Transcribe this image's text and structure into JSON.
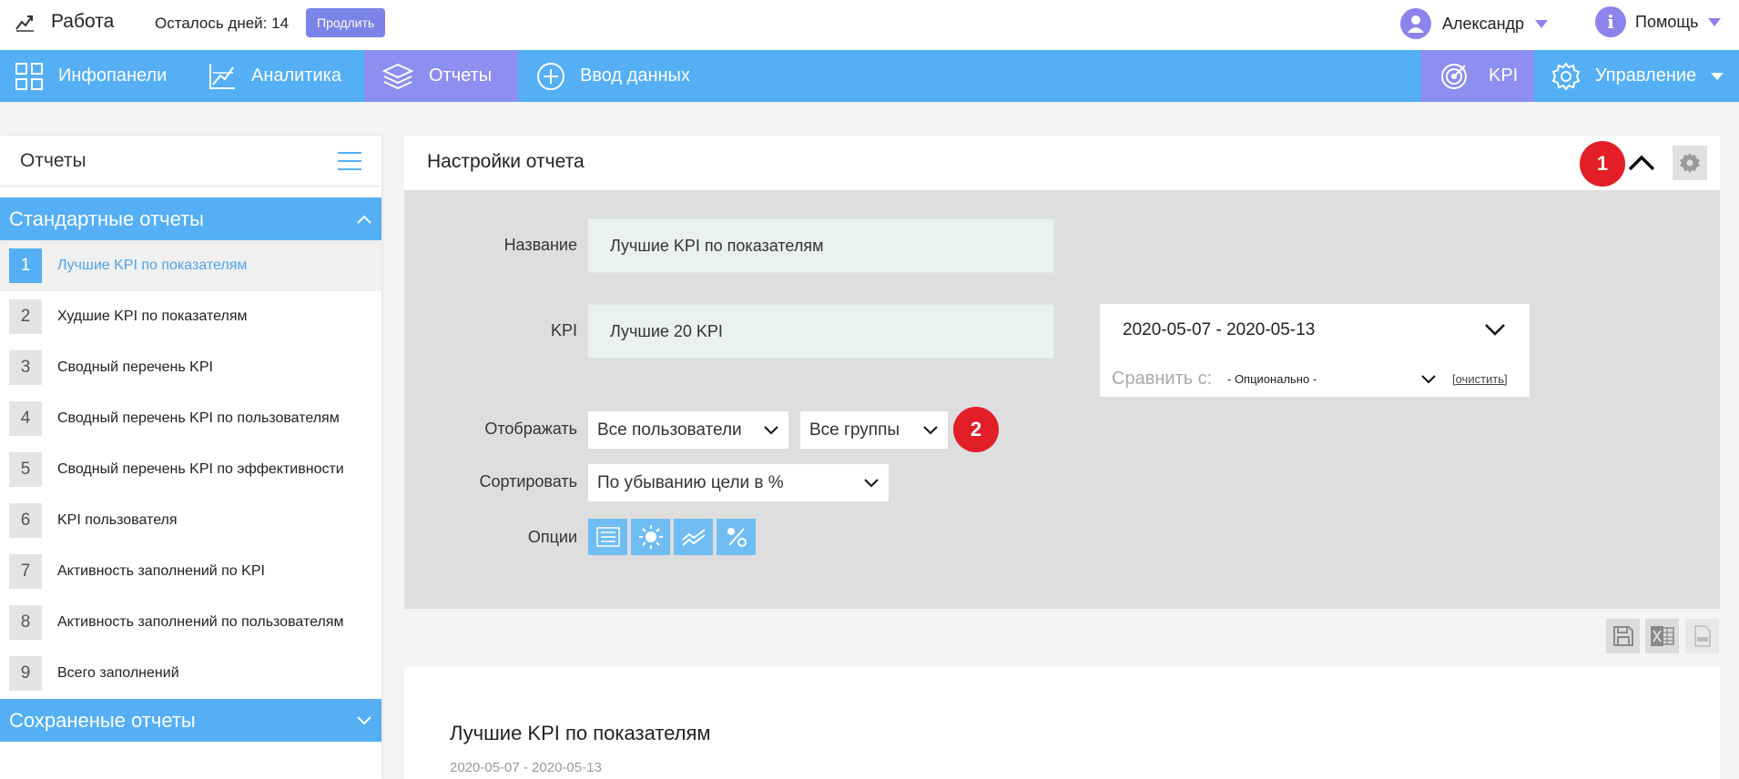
{
  "header": {
    "app_title": "Работа",
    "days_left": "Осталось дней: 14",
    "extend_label": "Продлить",
    "user_name": "Александр",
    "help_label": "Помощь",
    "help_glyph": "i"
  },
  "nav": {
    "items": [
      {
        "label": "Инфопанели",
        "icon": "grid-icon"
      },
      {
        "label": "Аналитика",
        "icon": "chart-icon"
      },
      {
        "label": "Отчеты",
        "icon": "layers-icon",
        "active": true
      },
      {
        "label": "Ввод данных",
        "icon": "plus-circle-icon"
      },
      {
        "label": "KPI",
        "icon": "target-icon",
        "active": true
      },
      {
        "label": "Управление",
        "icon": "gear-icon"
      }
    ]
  },
  "sidebar": {
    "title": "Отчеты",
    "standard_section": "Стандартные отчеты",
    "saved_section": "Сохраненые отчеты",
    "reports": [
      {
        "num": "1",
        "label": "Лучшие KPI по показателям",
        "active": true
      },
      {
        "num": "2",
        "label": "Худшие KPI по показателям"
      },
      {
        "num": "3",
        "label": "Сводный перечень KPI"
      },
      {
        "num": "4",
        "label": "Сводный перечень KPI по пользователям"
      },
      {
        "num": "5",
        "label": "Сводный перечень KPI по эффективности"
      },
      {
        "num": "6",
        "label": "KPI пользователя"
      },
      {
        "num": "7",
        "label": "Активность заполнений по KPI"
      },
      {
        "num": "8",
        "label": "Активность заполнений по пользователям"
      },
      {
        "num": "9",
        "label": "Всего заполнений"
      }
    ]
  },
  "settings": {
    "title": "Настройки отчета",
    "badge_1": "1",
    "badge_2": "2",
    "name_label": "Название",
    "name_value": "Лучшие KPI по показателям",
    "kpi_label": "KPI",
    "kpi_value": "Лучшие 20 KPI",
    "date_range": "2020-05-07 - 2020-05-13",
    "compare_label": "Сравнить с:",
    "compare_value": "- Опционально -",
    "clear_label": "[очистить]",
    "display_label": "Отображать",
    "users_value": "Все пользователи",
    "groups_value": "Все группы",
    "sort_label": "Сортировать",
    "sort_value": "По убыванию цели в %",
    "options_label": "Опции",
    "option_icons": [
      "list-icon",
      "sun-icon",
      "trend-icon",
      "percent-icon"
    ]
  },
  "result": {
    "title": "Лучшие KPI по показателям",
    "range": "2020-05-07 - 2020-05-13"
  },
  "colors": {
    "nav": "#54aff5",
    "accent": "#8c8ef0",
    "badge": "#e31e26"
  }
}
